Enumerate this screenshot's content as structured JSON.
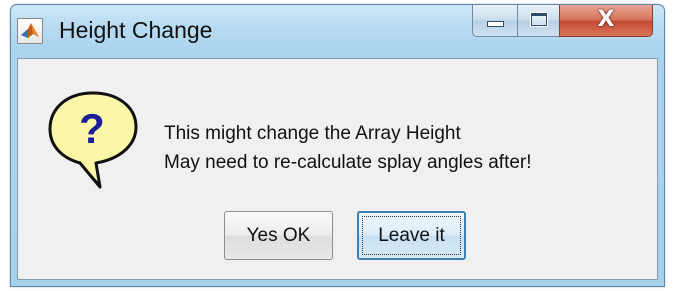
{
  "window": {
    "title": "Height Change",
    "app_icon": "matlab-icon",
    "caption_buttons": {
      "minimize_icon": "minimize-icon",
      "maximize_icon": "maximize-icon",
      "close_glyph": "X"
    }
  },
  "dialog": {
    "icon": "question-icon",
    "icon_glyph": "?",
    "message_line1": "This might change the Array Height",
    "message_line2": "May need to re-calculate splay angles after!"
  },
  "buttons": {
    "yes_label": "Yes OK",
    "leave_label": "Leave it"
  },
  "colors": {
    "titlebar": "#b9dcf2",
    "close_button": "#c34a32",
    "bubble_fill": "#fcf6a8",
    "question_mark": "#1b1f9a",
    "focused_button_border": "#3c7fb1"
  }
}
